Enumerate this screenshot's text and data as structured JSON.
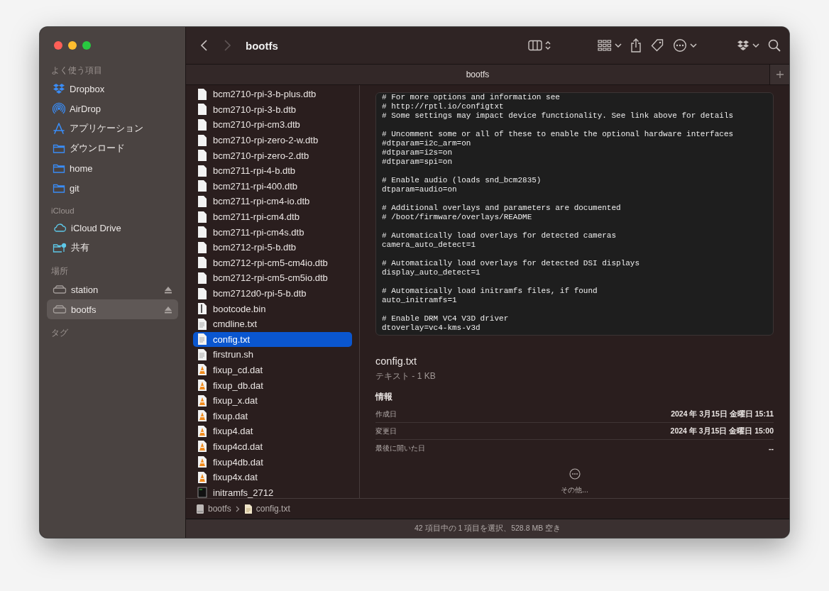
{
  "sidebar": {
    "sections": [
      {
        "title": "よく使う項目",
        "items": [
          {
            "label": "Dropbox",
            "kind": "dropbox",
            "selected": false,
            "ejectable": false
          },
          {
            "label": "AirDrop",
            "kind": "airdrop",
            "selected": false,
            "ejectable": false
          },
          {
            "label": "アプリケーション",
            "kind": "apps",
            "selected": false,
            "ejectable": false
          },
          {
            "label": "ダウンロード",
            "kind": "folder",
            "selected": false,
            "ejectable": false
          },
          {
            "label": "home",
            "kind": "folder",
            "selected": false,
            "ejectable": false
          },
          {
            "label": "git",
            "kind": "folder",
            "selected": false,
            "ejectable": false
          }
        ]
      },
      {
        "title": "iCloud",
        "items": [
          {
            "label": "iCloud Drive",
            "kind": "cloud",
            "selected": false,
            "ejectable": false
          },
          {
            "label": "共有",
            "kind": "shared",
            "selected": false,
            "ejectable": false
          }
        ]
      },
      {
        "title": "場所",
        "items": [
          {
            "label": "station",
            "kind": "drive",
            "selected": false,
            "ejectable": true
          },
          {
            "label": "bootfs",
            "kind": "drive",
            "selected": true,
            "ejectable": true
          }
        ]
      },
      {
        "title": "タグ"
      }
    ]
  },
  "toolbar": {
    "title": "bootfs",
    "navigation": [
      {
        "kind": "back",
        "disabled": false
      },
      {
        "kind": "forward",
        "disabled": true
      }
    ]
  },
  "tab_bar": {
    "label": "bootfs"
  },
  "files": [
    {
      "name": "bcm2710-rpi-3-b-plus.dtb",
      "kind": "blank",
      "selected": false
    },
    {
      "name": "bcm2710-rpi-3-b.dtb",
      "kind": "blank",
      "selected": false
    },
    {
      "name": "bcm2710-rpi-cm3.dtb",
      "kind": "blank",
      "selected": false
    },
    {
      "name": "bcm2710-rpi-zero-2-w.dtb",
      "kind": "blank",
      "selected": false
    },
    {
      "name": "bcm2710-rpi-zero-2.dtb",
      "kind": "blank",
      "selected": false
    },
    {
      "name": "bcm2711-rpi-4-b.dtb",
      "kind": "blank",
      "selected": false
    },
    {
      "name": "bcm2711-rpi-400.dtb",
      "kind": "blank",
      "selected": false
    },
    {
      "name": "bcm2711-rpi-cm4-io.dtb",
      "kind": "blank",
      "selected": false
    },
    {
      "name": "bcm2711-rpi-cm4.dtb",
      "kind": "blank",
      "selected": false
    },
    {
      "name": "bcm2711-rpi-cm4s.dtb",
      "kind": "blank",
      "selected": false
    },
    {
      "name": "bcm2712-rpi-5-b.dtb",
      "kind": "blank",
      "selected": false
    },
    {
      "name": "bcm2712-rpi-cm5-cm4io.dtb",
      "kind": "blank",
      "selected": false
    },
    {
      "name": "bcm2712-rpi-cm5-cm5io.dtb",
      "kind": "blank",
      "selected": false
    },
    {
      "name": "bcm2712d0-rpi-5-b.dtb",
      "kind": "blank",
      "selected": false
    },
    {
      "name": "bootcode.bin",
      "kind": "binary",
      "selected": false
    },
    {
      "name": "cmdline.txt",
      "kind": "text",
      "selected": false
    },
    {
      "name": "config.txt",
      "kind": "text",
      "selected": true
    },
    {
      "name": "firstrun.sh",
      "kind": "text",
      "selected": false
    },
    {
      "name": "fixup_cd.dat",
      "kind": "cone",
      "selected": false
    },
    {
      "name": "fixup_db.dat",
      "kind": "cone",
      "selected": false
    },
    {
      "name": "fixup_x.dat",
      "kind": "cone",
      "selected": false
    },
    {
      "name": "fixup.dat",
      "kind": "cone",
      "selected": false
    },
    {
      "name": "fixup4.dat",
      "kind": "cone",
      "selected": false
    },
    {
      "name": "fixup4cd.dat",
      "kind": "cone",
      "selected": false
    },
    {
      "name": "fixup4db.dat",
      "kind": "cone",
      "selected": false
    },
    {
      "name": "fixup4x.dat",
      "kind": "cone",
      "selected": false
    },
    {
      "name": "initramfs_2712",
      "kind": "terminal",
      "selected": false
    }
  ],
  "preview": {
    "code": "# For more options and information see\n# http://rptl.io/configtxt\n# Some settings may impact device functionality. See link above for details\n\n# Uncomment some or all of these to enable the optional hardware interfaces\n#dtparam=i2c_arm=on\n#dtparam=i2s=on\n#dtparam=spi=on\n\n# Enable audio (loads snd_bcm2835)\ndtparam=audio=on\n\n# Additional overlays and parameters are documented\n# /boot/firmware/overlays/README\n\n# Automatically load overlays for detected cameras\ncamera_auto_detect=1\n\n# Automatically load overlays for detected DSI displays\ndisplay_auto_detect=1\n\n# Automatically load initramfs files, if found\nauto_initramfs=1\n\n# Enable DRM VC4 V3D driver\ndtoverlay=vc4-kms-v3d",
    "file_name": "config.txt",
    "file_info": "テキスト - 1 KB",
    "info_heading": "情報",
    "info_rows": [
      {
        "label": "作成日",
        "value": "2024 年 3月15日 金曜日 15:11"
      },
      {
        "label": "変更日",
        "value": "2024 年 3月15日 金曜日 15:00"
      },
      {
        "label": "最後に開いた日",
        "value": "--"
      }
    ],
    "more_label": "その他..."
  },
  "path_bar": [
    {
      "label": "bootfs",
      "kind": "drive"
    },
    {
      "label": "config.txt",
      "kind": "text"
    }
  ],
  "status_bar": "42 項目中の 1 項目を選択、528.8 MB 空き"
}
